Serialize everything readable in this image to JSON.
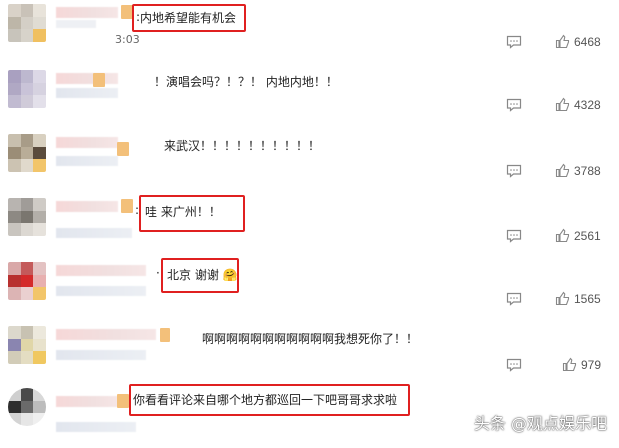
{
  "comments": [
    {
      "text": "内地希望能有机会",
      "time": "3:03",
      "likes": "6468",
      "highlighted": true
    },
    {
      "text": "！演唱会吗？！？！ 内地内地！！",
      "likes": "4328",
      "highlighted": false
    },
    {
      "text": "来武汉！！！！！！！！！！",
      "likes": "3788",
      "highlighted": false
    },
    {
      "text": "哇 来广州！！",
      "likes": "2561",
      "highlighted": true
    },
    {
      "text": "北京 谢谢",
      "emoji": "🤗",
      "likes": "1565",
      "highlighted": true
    },
    {
      "text": "啊啊啊啊啊啊啊啊啊啊啊我想死你了！！",
      "likes": "979",
      "highlighted": false
    },
    {
      "text": "你看看评论来自哪个地方都巡回一下吧哥哥求求啦",
      "highlighted": true
    }
  ],
  "icons": {
    "reply": "reply-icon",
    "like": "thumbs-up-icon"
  },
  "colors": {
    "highlight": "#e02020"
  },
  "watermark": "头条 @观点娱乐吧"
}
